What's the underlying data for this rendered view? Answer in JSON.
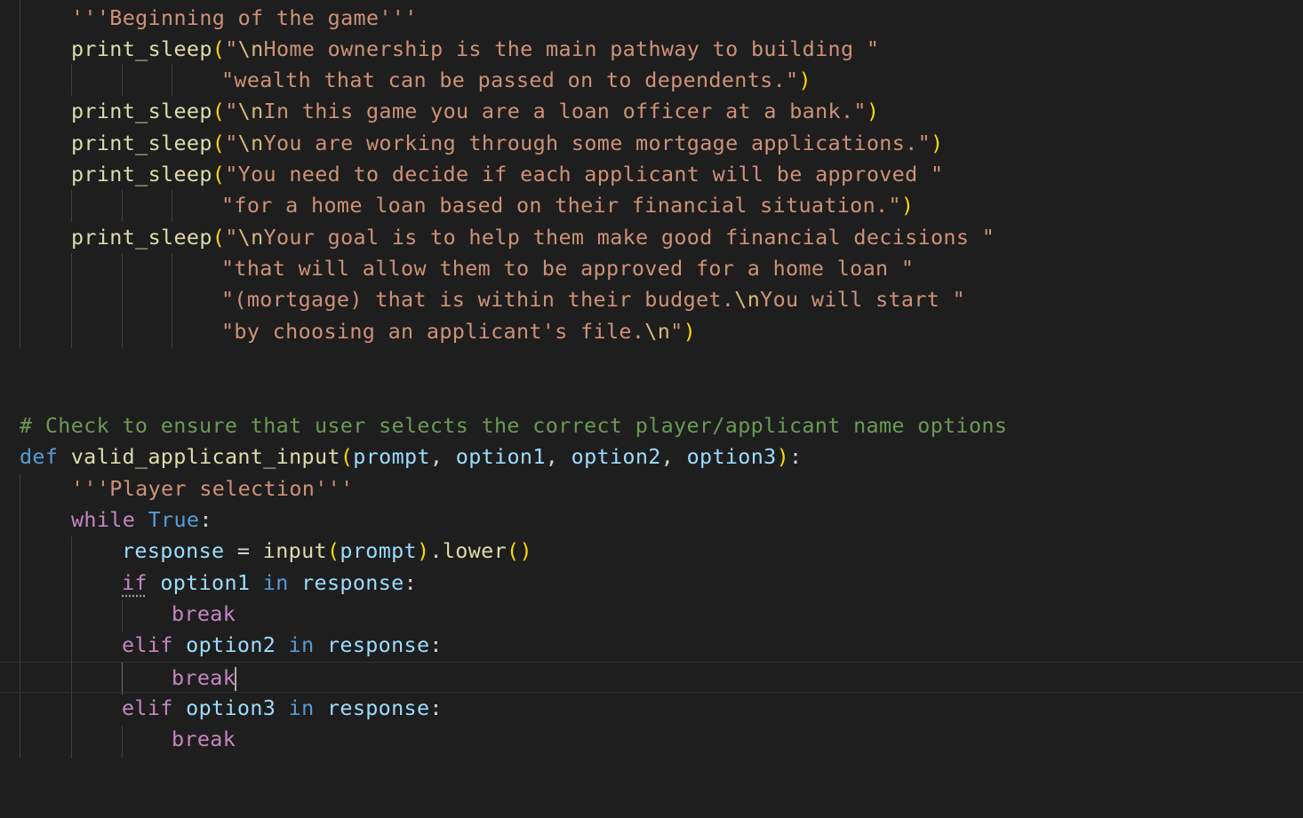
{
  "editor": {
    "language": "python",
    "theme_colors": {
      "background": "#1e1e1e",
      "string": "#ce9178",
      "function": "#dcdcaa",
      "keyword": "#569cd6",
      "control": "#c586c0",
      "variable": "#9cdcfe",
      "comment": "#6a9955",
      "bracket": "#ffd700"
    },
    "lines": {
      "l1": {
        "doc": "'''Beginning of the game'''"
      },
      "l2": {
        "fn": "print_sleep",
        "open": "(",
        "s1": "\"",
        "esc": "\\n",
        "s2": "Home ownership is the main pathway to building \""
      },
      "l3": {
        "s": "\"wealth that can be passed on to dependents.\"",
        "close": ")"
      },
      "l4": {
        "fn": "print_sleep",
        "open": "(",
        "s1": "\"",
        "esc": "\\n",
        "s2": "In this game you are a loan officer at a bank.\"",
        "close": ")"
      },
      "l5": {
        "fn": "print_sleep",
        "open": "(",
        "s1": "\"",
        "esc": "\\n",
        "s2": "You are working through some mortgage applications.\"",
        "close": ")"
      },
      "l6": {
        "fn": "print_sleep",
        "open": "(",
        "s2": "\"You need to decide if each applicant will be approved \""
      },
      "l7": {
        "s": "\"for a home loan based on their financial situation.\"",
        "close": ")"
      },
      "l8": {
        "fn": "print_sleep",
        "open": "(",
        "s1": "\"",
        "esc": "\\n",
        "s2": "Your goal is to help them make good financial decisions \""
      },
      "l9": {
        "s": "\"that will allow them to be approved for a home loan \""
      },
      "l10": {
        "s1": "\"(mortgage) that is within their budget.",
        "esc": "\\n",
        "s2": "You will start \""
      },
      "l11": {
        "s1": "\"by choosing an applicant's file.",
        "esc": "\\n",
        "s2": "\"",
        "close": ")"
      },
      "l14": {
        "comment": "# Check to ensure that user selects the correct player/applicant name options"
      },
      "l15": {
        "kw": "def",
        "fn": "valid_applicant_input",
        "open": "(",
        "p1": "prompt",
        "c1": ", ",
        "p2": "option1",
        "c2": ", ",
        "p3": "option2",
        "c3": ", ",
        "p4": "option3",
        "close": ")",
        "colon": ":"
      },
      "l16": {
        "doc": "'''Player selection'''"
      },
      "l17": {
        "kw": "while",
        "val": "True",
        "colon": ":"
      },
      "l18": {
        "var": "response",
        "eq": " = ",
        "fn": "input",
        "open": "(",
        "arg": "prompt",
        "close": ")",
        "dot": ".",
        "fn2": "lower",
        "open2": "(",
        "close2": ")"
      },
      "l19": {
        "kw": "if",
        "v1": "option1",
        "in": "in",
        "v2": "response",
        "colon": ":"
      },
      "l20": {
        "kw": "break"
      },
      "l21": {
        "kw": "elif",
        "v1": "option2",
        "in": "in",
        "v2": "response",
        "colon": ":"
      },
      "l22": {
        "kw1": "break"
      },
      "l23": {
        "kw": "elif",
        "v1": "option3",
        "in": "in",
        "v2": "response",
        "colon": ":"
      },
      "l24": {
        "kw": "break"
      }
    }
  }
}
